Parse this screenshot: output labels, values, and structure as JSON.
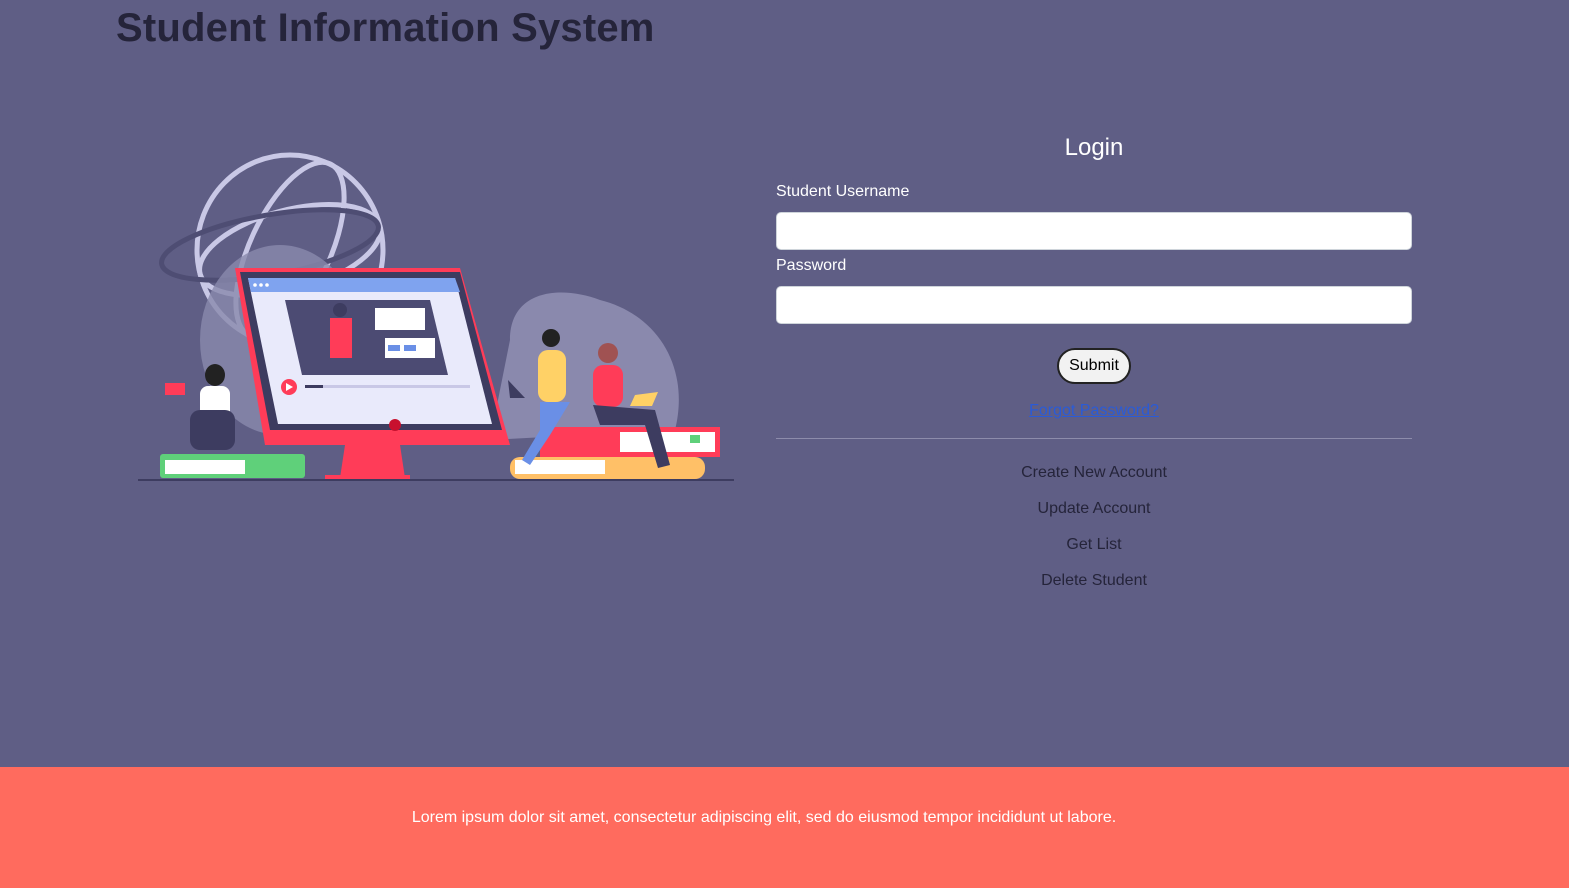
{
  "header": {
    "title": "Student Information System"
  },
  "login": {
    "heading": "Login",
    "username_label": "Student Username",
    "username_value": "",
    "password_label": "Password",
    "password_value": "",
    "submit_label": "Submit",
    "forgot_label": "Forgot Password?"
  },
  "links": [
    {
      "label": "Create New Account"
    },
    {
      "label": "Update Account"
    },
    {
      "label": "Get List"
    },
    {
      "label": "Delete Student"
    }
  ],
  "footer": {
    "text": "Lorem ipsum dolor sit amet, consectetur adipiscing elit, sed do eiusmod tempor incididunt ut labore."
  },
  "colors": {
    "background": "#5f5e85",
    "footer": "#ff6b5e",
    "title": "#25243a",
    "link": "#2a5bd7"
  }
}
